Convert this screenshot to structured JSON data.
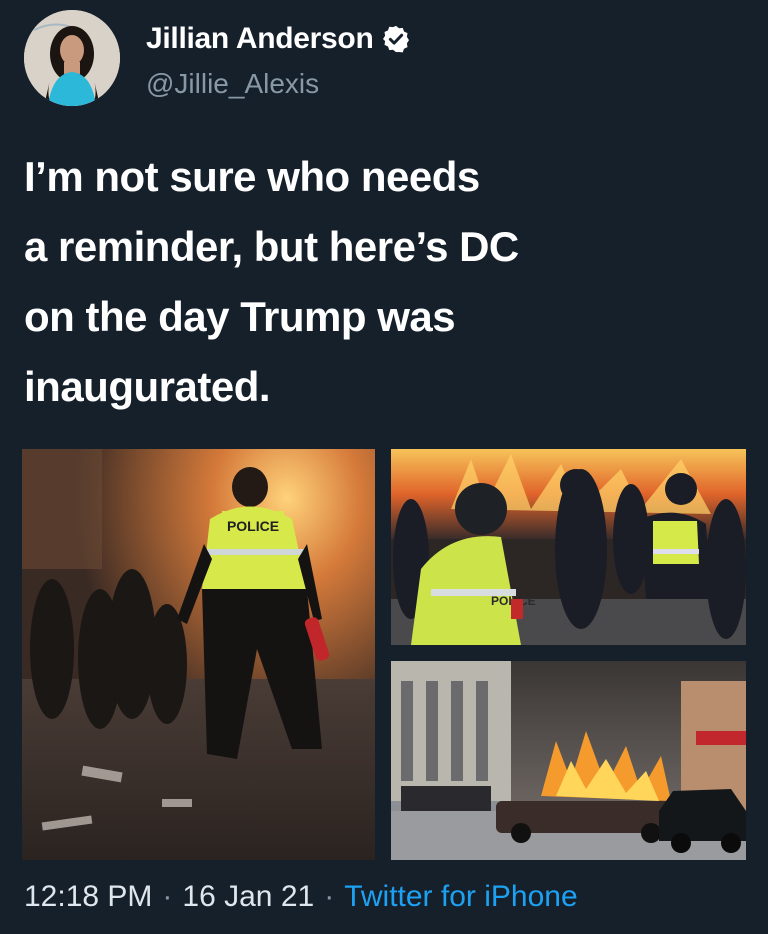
{
  "author": {
    "display_name": "Jillian Anderson",
    "handle": "@Jillie_Alexis",
    "verified": true,
    "verified_icon": "verified-badge-icon"
  },
  "tweet": {
    "lines": [
      "I’m not sure who needs",
      "a reminder, but here’s DC",
      "on the day Trump was",
      "inaugurated."
    ]
  },
  "media": {
    "photo_left_vest_text": "POLICE",
    "photo_top_right_vest_text": "POLICE"
  },
  "meta": {
    "time": "12:18 PM",
    "separator": "·",
    "date": "16 Jan 21",
    "source": "Twitter for iPhone"
  },
  "colors": {
    "background": "#15202b",
    "secondary_text": "#8899a6",
    "link": "#1da1f2",
    "verified": "#ffffff"
  }
}
